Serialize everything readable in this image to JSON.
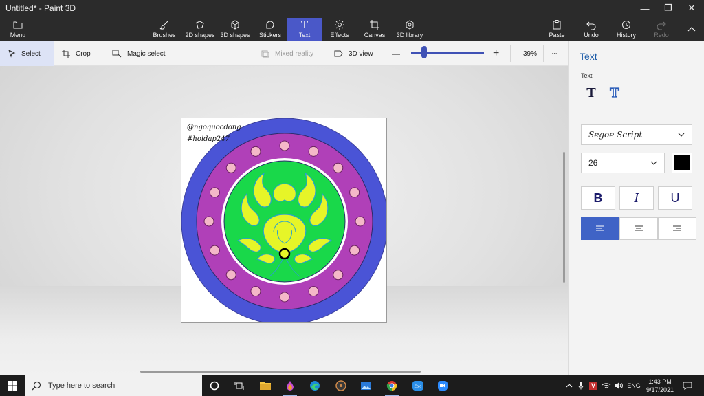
{
  "window": {
    "title": "Untitled* - Paint 3D",
    "minimize_glyph": "—",
    "restore_glyph": "❐",
    "close_glyph": "✕"
  },
  "ribbon": {
    "menu": "Menu",
    "brushes": "Brushes",
    "shapes2d": "2D shapes",
    "shapes3d": "3D shapes",
    "stickers": "Stickers",
    "text": "Text",
    "effects": "Effects",
    "canvas": "Canvas",
    "library3d": "3D library",
    "paste": "Paste",
    "undo": "Undo",
    "history": "History",
    "redo": "Redo",
    "active_tab": "Text",
    "accent_color": "#4a58c8"
  },
  "toolbar": {
    "select": "Select",
    "crop": "Crop",
    "magic_select": "Magic select",
    "mixed_reality": "Mixed reality",
    "view3d": "3D view",
    "zoom_minus": "—",
    "zoom_plus": "+",
    "zoom_value": "39%",
    "more": "···",
    "zoom_level": 0.39
  },
  "canvas": {
    "watermark_line1": "@ngoquocdong",
    "watermark_line2": "#hoidap247",
    "colors": {
      "outer_ring": "#4a54d6",
      "middle_ring": "#b040b8",
      "inner_disc": "#19d84a",
      "motif": "#e6f528",
      "dots": "#f4b8c8"
    }
  },
  "text_panel": {
    "title": "Text",
    "section_label": "Text",
    "font_family": "Segoe Script",
    "font_size": "26",
    "color": "#000000",
    "bold": "B",
    "italic": "I",
    "underline": "U",
    "alignment": "left",
    "accent_color": "#3f63c6"
  },
  "taskbar": {
    "search_placeholder": "Type here to search",
    "language": "ENG",
    "time": "1:43 PM",
    "date": "9/17/2021",
    "zalo_label": "Zalo",
    "tray_v": "V"
  }
}
